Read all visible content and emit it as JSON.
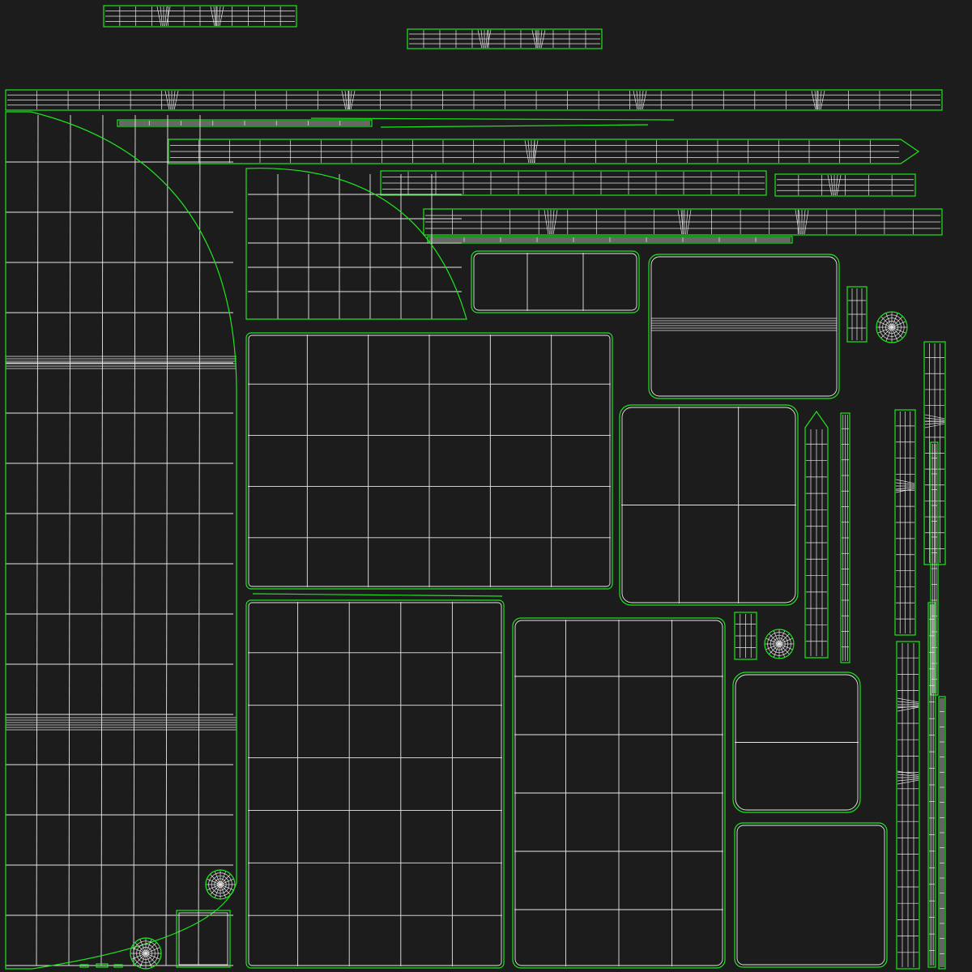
{
  "colors": {
    "background": "#1c1c1c",
    "island_outline": "#1ee61e",
    "wireframe": "#e8e8e8"
  }
}
